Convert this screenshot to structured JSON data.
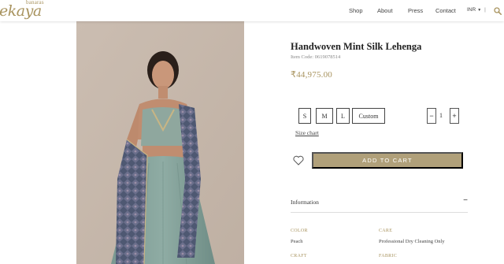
{
  "header": {
    "logo_sub": "banaras",
    "logo_main": "ekaya",
    "nav": [
      "Shop",
      "About",
      "Press",
      "Contact"
    ],
    "currency": "INR",
    "separator": "|"
  },
  "product": {
    "title": "Handwoven Mint Silk Lehenga",
    "item_code": "Item Code: 0619078514",
    "price": "₹44,975.00",
    "sizes": [
      "S",
      "M",
      "L",
      "Custom"
    ],
    "quantity": "1",
    "qty_minus": "−",
    "qty_plus": "+",
    "size_chart": "Size chart",
    "add_to_cart": "ADD TO CART"
  },
  "information": {
    "label": "Information",
    "toggle": "−",
    "color_label": "COLOR",
    "color_value": "Peach",
    "care_label": "CARE",
    "care_value": "Professional Dry Cleaning Only",
    "craft_label": "CRAFT",
    "fabric_label": "FABRIC"
  },
  "colors": {
    "accent": "#a8935e",
    "button": "#b0a07a",
    "photo_background": "#c9bbaf",
    "lehenga": "#7f9e96"
  },
  "icons": {
    "search": "search-icon",
    "wishlist": "heart-icon"
  }
}
